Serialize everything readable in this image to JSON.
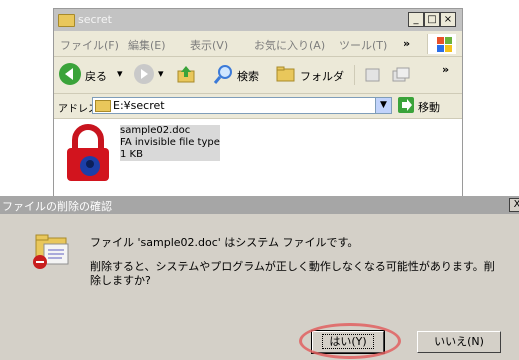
{
  "explorer": {
    "title": "secret",
    "menu": [
      "ファイル(F)",
      "編集(E)",
      "表示(V)",
      "お気に入り(A)",
      "ツール(T)"
    ],
    "menu_more": "»",
    "toolbar": {
      "back_label": "戻る",
      "search_label": "検索",
      "folders_label": "フォルダ",
      "more": "»"
    },
    "address": {
      "label": "アドレス(D)",
      "value": "E:¥secret",
      "go_label": "移動"
    },
    "file": {
      "name": "sample02.doc",
      "type": "FA invisible file type",
      "size": "1 KB"
    }
  },
  "dialog": {
    "title": "ファイルの削除の確認",
    "message1": "ファイル 'sample02.doc' はシステム ファイルです。",
    "message2": "削除すると、システムやプログラムが正しく動作しなくなる可能性があります。削除しますか?",
    "yes_label": "はい(Y)",
    "no_label": "いいえ(N)",
    "close_glyph": "X"
  },
  "colors": {
    "highlight": "#e06060",
    "dialog_bg": "#d4d0c8",
    "explorer_bg": "#ece9d8"
  }
}
